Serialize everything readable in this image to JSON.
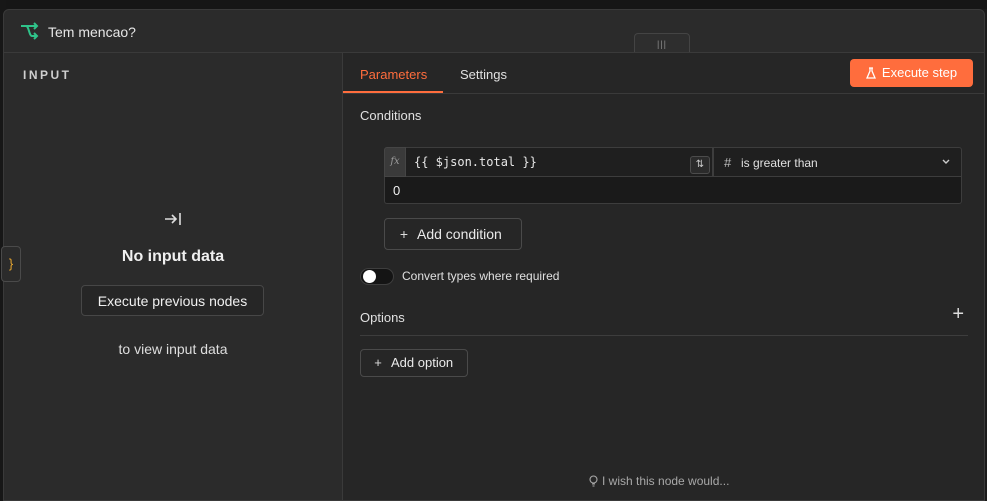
{
  "node": {
    "title": "Tem mencao?"
  },
  "input_panel": {
    "heading": "INPUT",
    "empty_title": "No input data",
    "execute_previous_label": "Execute previous nodes",
    "hint": "to view input data"
  },
  "side_tab": {
    "symbol": "}"
  },
  "tabs": [
    {
      "label": "Parameters",
      "active": true
    },
    {
      "label": "Settings",
      "active": false
    }
  ],
  "execute_step_label": "Execute step",
  "conditions": {
    "label": "Conditions",
    "rows": [
      {
        "fx": "fx",
        "expression": "{{ $json.total }}",
        "operator_symbol": "#",
        "operator": "is greater than",
        "value": "0"
      }
    ],
    "add_label": "Add condition"
  },
  "convert_types": {
    "label": "Convert types where required",
    "enabled": false
  },
  "options": {
    "label": "Options",
    "plus": "+",
    "add_label": "Add option"
  },
  "feedback": {
    "label": "I wish this node would..."
  },
  "colors": {
    "accent": "#ff6d3d",
    "brace": "#e5a530",
    "icon_green": "#2fc38a"
  }
}
